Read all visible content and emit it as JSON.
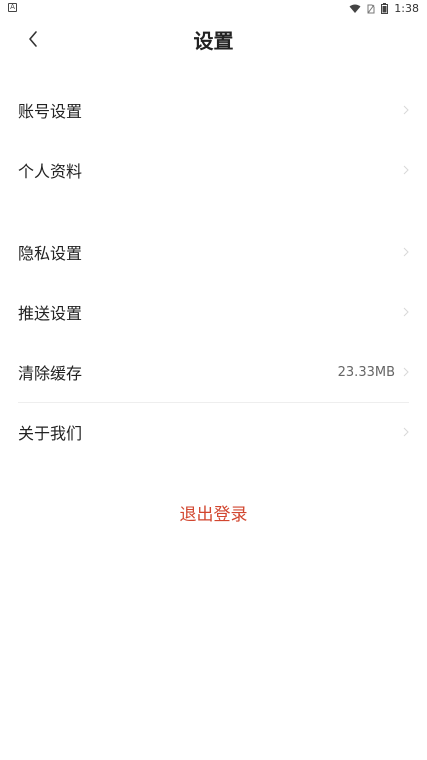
{
  "status_bar": {
    "time": "1:38",
    "left_icon": "A"
  },
  "header": {
    "title": "设置"
  },
  "groups": [
    {
      "items": [
        {
          "label": "账号设置"
        },
        {
          "label": "个人资料"
        }
      ]
    },
    {
      "items": [
        {
          "label": "隐私设置"
        },
        {
          "label": "推送设置"
        },
        {
          "label": "清除缓存",
          "value": "23.33MB"
        },
        {
          "label": "关于我们"
        }
      ]
    }
  ],
  "logout": {
    "label": "退出登录"
  },
  "colors": {
    "accent": "#d2462f",
    "divider": "#eeeeee"
  }
}
